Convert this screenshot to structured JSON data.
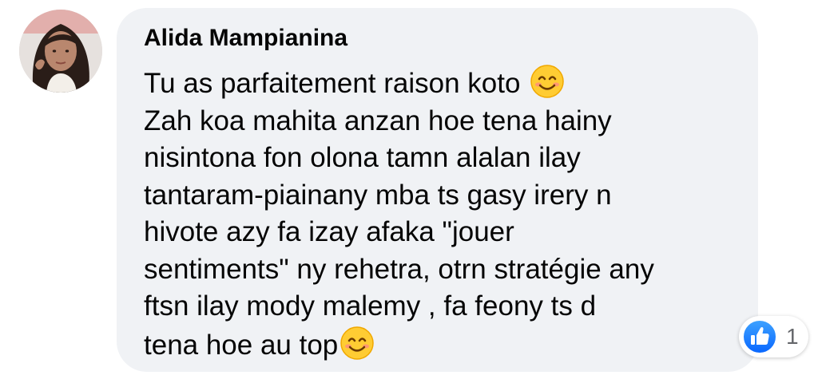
{
  "comment": {
    "author": "Alida Mampianina",
    "lines": [
      "Tu as parfaitement raison koto",
      "Zah koa mahita anzan hoe tena hainy",
      "nisintona fon olona tamn alalan ilay",
      "tantaram-piainany mba ts gasy irery n",
      "hivote azy fa izay afaka \"jouer",
      "sentiments\" ny rehetra, otrn stratégie any",
      "ftsn ilay mody malemy , fa feony ts d",
      "tena hoe au top"
    ],
    "emoji": "smiling-face-with-smiling-eyes"
  },
  "reactions": {
    "icon": "like-icon",
    "count": "1",
    "color": "#1877f2"
  },
  "colors": {
    "bubble": "#f0f2f5",
    "text": "#050505",
    "muted": "#65676b"
  }
}
